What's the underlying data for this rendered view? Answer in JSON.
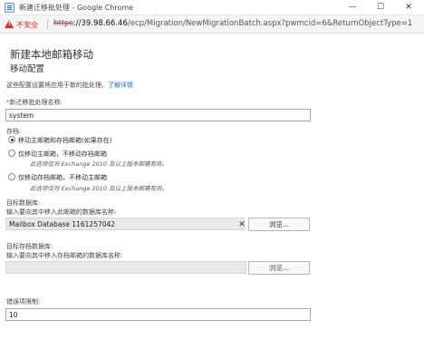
{
  "window": {
    "title": "新建迁移批处理 - Google Chrome",
    "minimize": "—",
    "maximize": "☐",
    "close": "✕"
  },
  "address": {
    "security_label": "不安全",
    "url_scheme": "https",
    "url_host": "://39.98.66.46",
    "url_rest": "/ecp/Migration/NewMigrationBatch.aspx?pwmcid=6&ReturnObjectType=1"
  },
  "page": {
    "title": "新建本地邮箱移动",
    "subtitle": "移动配置",
    "hint_text": "这些配置设置将应用于新的批处理。",
    "learn_more": "了解详情"
  },
  "batch_name": {
    "required_mark": "*",
    "label": "新迁移批处理名称:",
    "value": "system"
  },
  "archive": {
    "label": "存档:",
    "options": [
      {
        "label": "移动主邮箱和存档邮箱(如果存在)",
        "sub": "",
        "selected": true
      },
      {
        "label": "仅移动主邮箱，不移动存档邮箱",
        "sub": "此选项仅对 Exchange 2010 及以上版本邮箱有效。",
        "selected": false
      },
      {
        "label": "仅移动存档邮箱，不移动主邮箱",
        "sub": "此选项仅对 Exchange 2010 及以上版本邮箱有效。",
        "selected": false
      }
    ]
  },
  "target_db": {
    "label": "目标数据库:",
    "sublabel": "输入要向其中移入此邮箱的数据库名称:",
    "value": "Mailbox Database 1161257042",
    "clear": "✕",
    "browse_label": "浏览..."
  },
  "target_archive_db": {
    "label": "目标存档数据库:",
    "sublabel": "输入要向其中移入存档邮箱的数据库名称:",
    "value": "",
    "browse_label": "浏览..."
  },
  "bad_item_limit": {
    "label": "错误项限制:",
    "value": "10"
  },
  "colors": {
    "warning": "#d93025",
    "link": "#1a6ed6",
    "disabled_field": "#e8e8e8"
  }
}
